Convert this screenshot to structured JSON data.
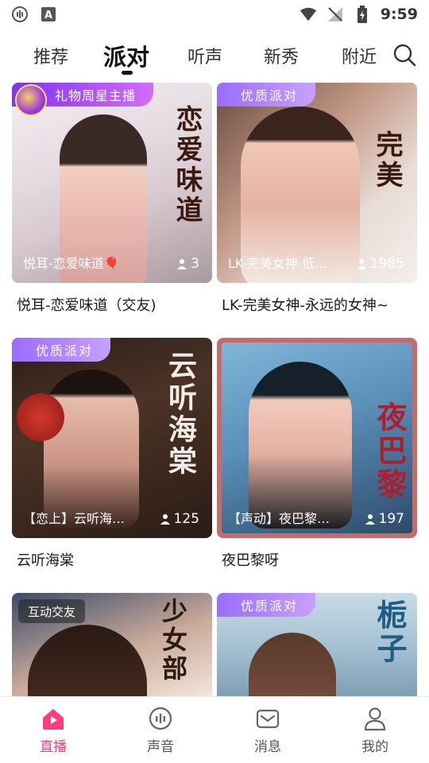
{
  "status_bar": {
    "time": "9:59"
  },
  "top_tabs": [
    {
      "label": "推荐"
    },
    {
      "label": "派对"
    },
    {
      "label": "听声"
    },
    {
      "label": "新秀"
    },
    {
      "label": "附近"
    }
  ],
  "cards": [
    {
      "badge": "礼物周星主播",
      "cover_name": "悦耳-恋爱味道🎈",
      "count": "3",
      "title": "悦耳-恋爱味道（交友)",
      "calligraphy": "恋爱味道"
    },
    {
      "badge": "优质派对",
      "cover_name": "LK-完美女神-低…",
      "count": "1985",
      "title": "LK-完美女神-永远的女神~",
      "calligraphy": "完美"
    },
    {
      "badge": "优质派对",
      "cover_name": "【恋上】云听海…",
      "count": "125",
      "title": "云听海棠",
      "calligraphy": "云听海棠"
    },
    {
      "badge": "",
      "cover_name": "【声动】夜巴黎…",
      "count": "197",
      "title": "夜巴黎呀",
      "calligraphy": "夜巴黎"
    },
    {
      "badge": "互动交友",
      "cover_name": "",
      "count": "",
      "title": "",
      "calligraphy": "少女部"
    },
    {
      "badge": "优质派对",
      "cover_name": "",
      "count": "",
      "title": "",
      "calligraphy": "栀子"
    }
  ],
  "bottom_nav": [
    {
      "label": "直播"
    },
    {
      "label": "声音"
    },
    {
      "label": "消息"
    },
    {
      "label": "我的"
    }
  ],
  "colors": {
    "accent": "#ff3d7f",
    "badge_purple": "#9b6cff"
  }
}
